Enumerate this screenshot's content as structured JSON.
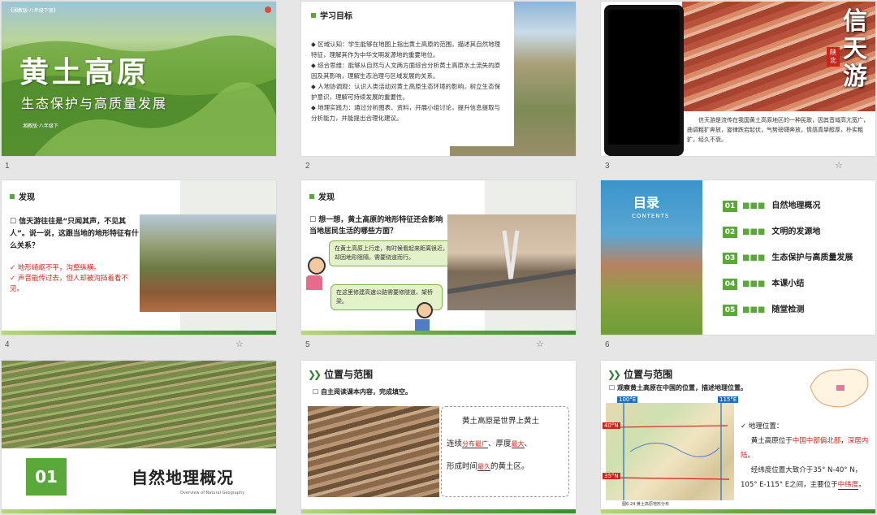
{
  "slides": [
    {
      "number": "1",
      "tag": "【湘教版·八年级下册】",
      "title": "黄土高原",
      "subtitle": "生态保护与高质量发展",
      "footer": "湘教版·八年级下"
    },
    {
      "number": "2",
      "header": "学习目标",
      "items": [
        "区域认知：学生能够在地图上指出黄土高原的范围，描述其自然地理特征，理解其作为中华文明发源地的重要地位。",
        "综合思维：能够从自然与人文两方面综合分析黄土高原水土流失的原因及其影响，理解生态治理与区域发展的关系。",
        "人地协调观：认识人类活动对黄土高原生态环境的影响，树立生态保护意识，理解可持续发展的重要性。",
        "地理实践力：通过分析图表、资料，开展小组讨论，提升信息提取与分析能力，并能提出合理化建议。"
      ]
    },
    {
      "number": "3",
      "big": "信天游",
      "stamp": "陕北",
      "desc": "信天游是流传在我国黄土高原地区的一种民歌，因其音域高亢宽广，曲调粗犷奔放，旋律跌宕起伏，气势磅礴奔放，情感真挚醇厚，朴实粗犷，经久不衰。"
    },
    {
      "number": "4",
      "header": "发现",
      "question": "信天游往往是“只闻其声，不见其人”。说一说，这跟当地的地形特征有什么关系？",
      "answers": [
        "地形崎岖不平，沟壑纵横。",
        "声音能传过去，但人却被沟挡着看不见。"
      ]
    },
    {
      "number": "5",
      "header": "发现",
      "question": "想一想，黄土高原的地形特征还会影响当地居民生活的哪些方面？",
      "bubble1": "在黄土高原上行走，有时候看起来距离很近，却因地形阻隔，需要绕道而行。",
      "bubble2": "在这里修建高速公路需要修隧道、架桥梁。"
    },
    {
      "number": "6",
      "toc_title": "目录",
      "toc_en": "CONTENTS",
      "toc": [
        {
          "n": "01",
          "label": "自然地理概况"
        },
        {
          "n": "02",
          "label": "文明的发源地"
        },
        {
          "n": "03",
          "label": "生态保护与高质量发展"
        },
        {
          "n": "04",
          "label": "本课小结"
        },
        {
          "n": "05",
          "label": "随堂检测"
        }
      ]
    },
    {
      "number": "7",
      "n": "01",
      "title": "自然地理概况",
      "en": "Overview of Natural Geography"
    },
    {
      "number": "8",
      "header": "位置与范围",
      "instruction": "自主阅读课本内容，完成填空。",
      "p1": "黄土高原是世界上黄土",
      "p2a": "连续",
      "blank1": "分布最广",
      "p2b": "、厚度",
      "blank2": "最大",
      "p2c": "、",
      "p3a": "形成时间",
      "blank3": "最久",
      "p3b": "的黄土区。"
    },
    {
      "number": "9",
      "header": "位置与范围",
      "instruction": "观察黄土高原在中国的位置，描述地理位置。",
      "lon1": "100°E",
      "lon2": "115°E",
      "lat1": "40°N",
      "lat2": "35°N",
      "map_caption": "图6-24 黄土高原地形分布",
      "pos_label": "地理位置：",
      "pos1a": "黄土高原位于",
      "pos1b": "中国中部偏北部",
      "pos1c": "，",
      "pos1d": "深居内陆",
      "pos1e": "。",
      "pos2": "经纬度位置大致介于35° N-40° N，105° E-115° E之间，主要位于",
      "pos2b": "中纬度",
      "pos2c": "。"
    }
  ],
  "colors": {
    "accent_green": "#5aa83a",
    "dark_green": "#2e7d32",
    "red": "#d0241c",
    "map_blue": "#1f6fbf"
  }
}
